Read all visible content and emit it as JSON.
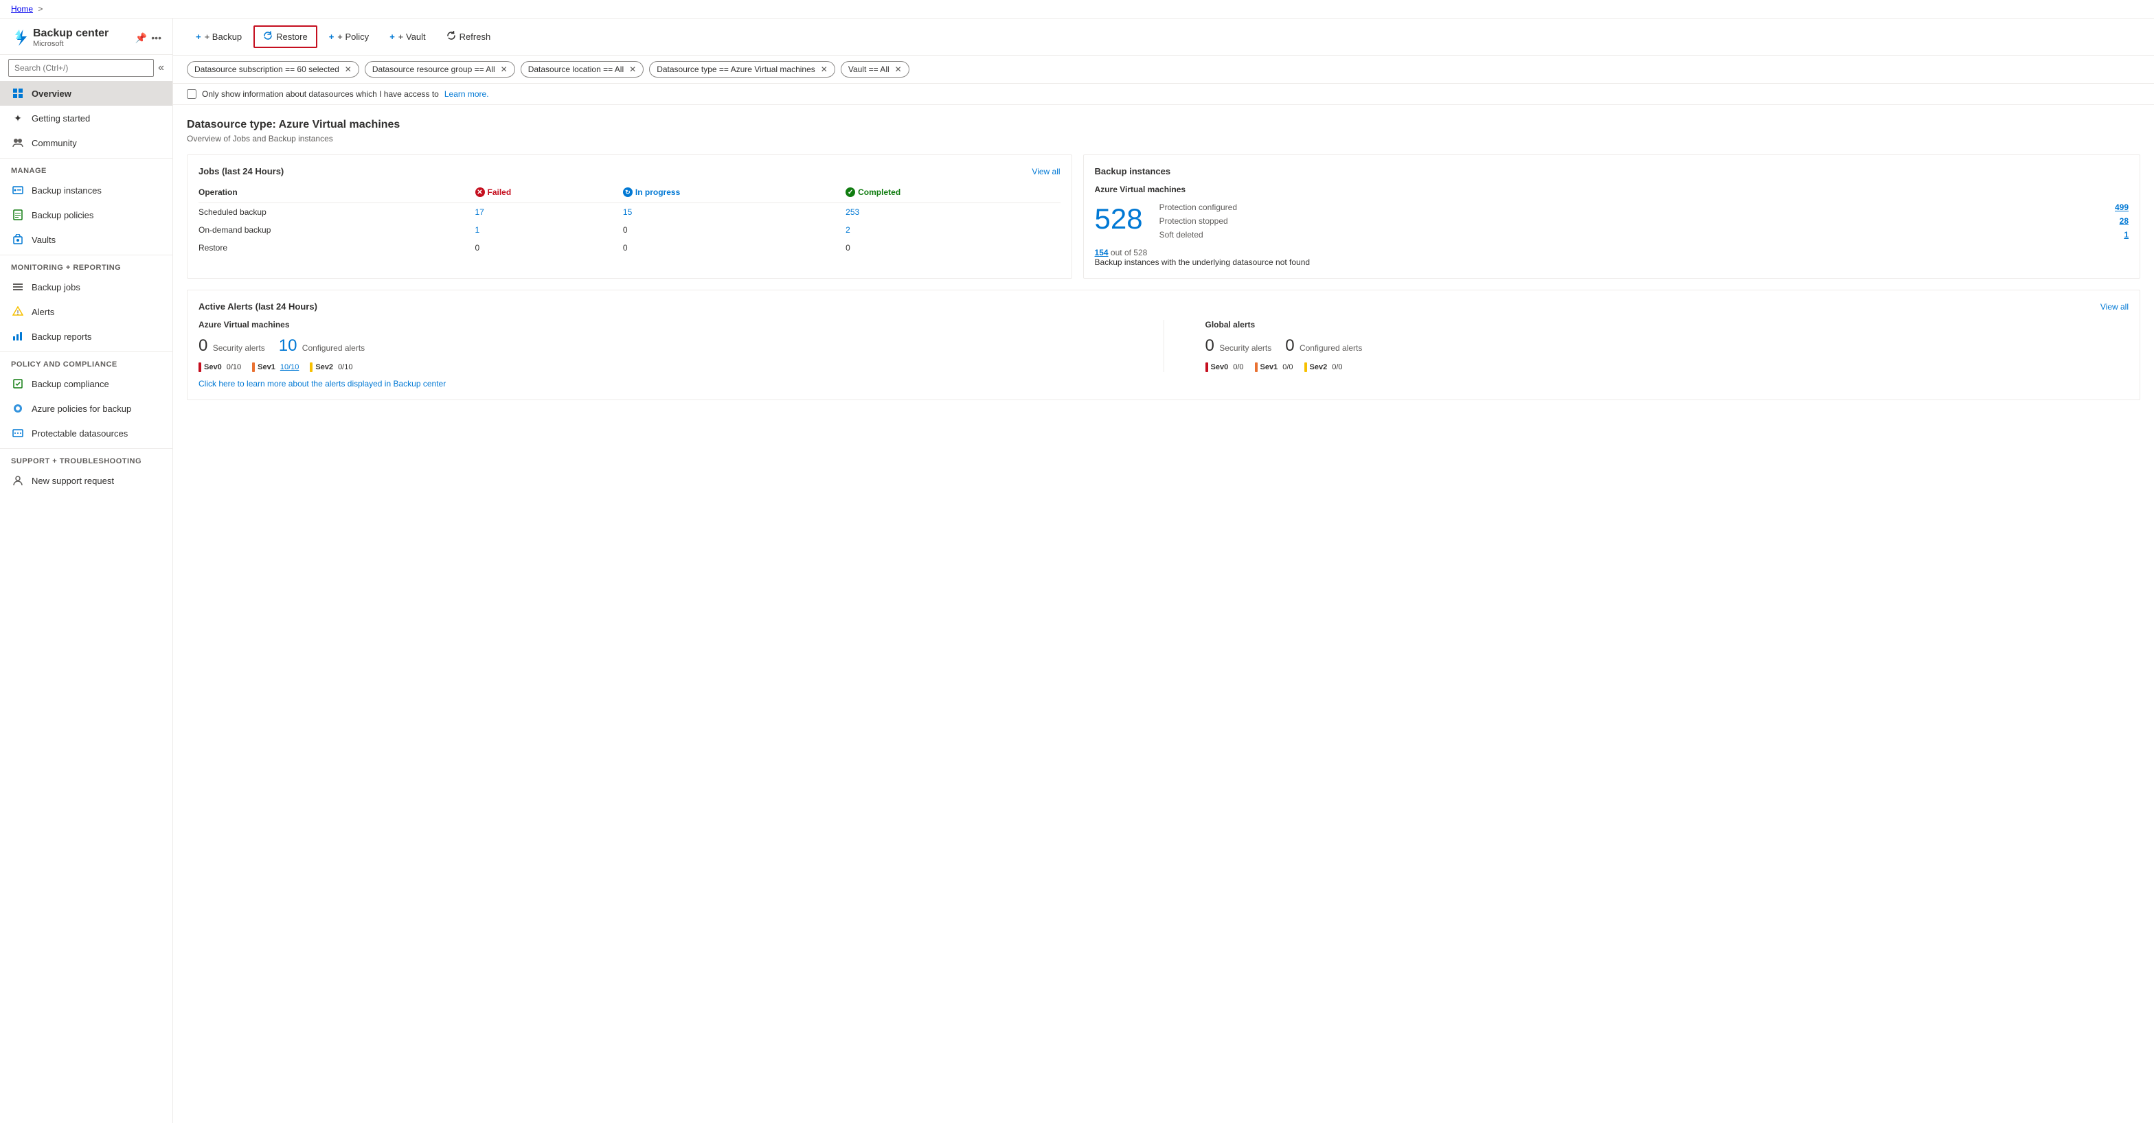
{
  "breadcrumb": {
    "home": "Home",
    "separator": ">"
  },
  "sidebar": {
    "title": "Backup center",
    "subtitle": "Microsoft",
    "search_placeholder": "Search (Ctrl+/)",
    "nav_items": [
      {
        "id": "overview",
        "label": "Overview",
        "icon": "⊟",
        "active": true
      },
      {
        "id": "getting-started",
        "label": "Getting started",
        "icon": "✦"
      },
      {
        "id": "community",
        "label": "Community",
        "icon": "👥"
      }
    ],
    "manage_section": "Manage",
    "manage_items": [
      {
        "id": "backup-instances",
        "label": "Backup instances",
        "icon": "📦"
      },
      {
        "id": "backup-policies",
        "label": "Backup policies",
        "icon": "📋"
      },
      {
        "id": "vaults",
        "label": "Vaults",
        "icon": "🔒"
      }
    ],
    "monitoring_section": "Monitoring + reporting",
    "monitoring_items": [
      {
        "id": "backup-jobs",
        "label": "Backup jobs",
        "icon": "≡"
      },
      {
        "id": "alerts",
        "label": "Alerts",
        "icon": "⚠"
      },
      {
        "id": "backup-reports",
        "label": "Backup reports",
        "icon": "📊"
      }
    ],
    "policy_section": "Policy and compliance",
    "policy_items": [
      {
        "id": "backup-compliance",
        "label": "Backup compliance",
        "icon": "✅"
      },
      {
        "id": "azure-policies",
        "label": "Azure policies for backup",
        "icon": "🔵"
      },
      {
        "id": "protectable-datasources",
        "label": "Protectable datasources",
        "icon": "🗄"
      }
    ],
    "support_section": "Support + troubleshooting",
    "support_items": [
      {
        "id": "new-support-request",
        "label": "New support request",
        "icon": "👤"
      }
    ]
  },
  "toolbar": {
    "backup_label": "+ Backup",
    "restore_label": "Restore",
    "policy_label": "+ Policy",
    "vault_label": "+ Vault",
    "refresh_label": "Refresh"
  },
  "filters": {
    "subscription": "Datasource subscription == 60 selected",
    "resource_group": "Datasource resource group == All",
    "location": "Datasource location == All",
    "datasource_type": "Datasource type == Azure Virtual machines",
    "vault": "Vault == All",
    "checkbox_label": "Only show information about datasources which I have access to",
    "learn_more": "Learn more."
  },
  "page": {
    "title": "Datasource type: Azure Virtual machines",
    "subtitle": "Overview of Jobs and Backup instances"
  },
  "jobs_card": {
    "title": "Jobs (last 24 Hours)",
    "view_all": "View all",
    "headers": {
      "operation": "Operation",
      "failed": "Failed",
      "in_progress": "In progress",
      "completed": "Completed"
    },
    "rows": [
      {
        "operation": "Scheduled backup",
        "failed": "17",
        "in_progress": "15",
        "completed": "253"
      },
      {
        "operation": "On-demand backup",
        "failed": "1",
        "in_progress": "0",
        "completed": "2"
      },
      {
        "operation": "Restore",
        "failed": "0",
        "in_progress": "0",
        "completed": "0"
      }
    ]
  },
  "backup_instances_card": {
    "title": "Backup instances",
    "subtitle": "Azure Virtual machines",
    "big_number": "528",
    "protection_configured_label": "Protection configured",
    "protection_configured_value": "499",
    "protection_stopped_label": "Protection stopped",
    "protection_stopped_value": "28",
    "soft_deleted_label": "Soft deleted",
    "soft_deleted_value": "1",
    "datasource_note_number": "154",
    "datasource_note_of": "out of 528",
    "datasource_note_text": "Backup instances with the underlying datasource not found"
  },
  "alerts_card": {
    "title": "Active Alerts (last 24 Hours)",
    "view_all": "View all",
    "azure_vm_section": "Azure Virtual machines",
    "azure_security_label": "Security alerts",
    "azure_security_count": "0",
    "azure_configured_label": "Configured alerts",
    "azure_configured_count": "10",
    "azure_sevs": [
      {
        "label": "Sev0",
        "value": "0/10",
        "color": "sev0-color"
      },
      {
        "label": "Sev1",
        "value": "10/10",
        "color": "sev1-color",
        "blue": true
      },
      {
        "label": "Sev2",
        "value": "0/10",
        "color": "sev2-color"
      }
    ],
    "global_section": "Global alerts",
    "global_security_label": "Security alerts",
    "global_security_count": "0",
    "global_configured_label": "Configured alerts",
    "global_configured_count": "0",
    "global_sevs": [
      {
        "label": "Sev0",
        "value": "0/0",
        "color": "sev0-color"
      },
      {
        "label": "Sev1",
        "value": "0/0",
        "color": "sev1-color"
      },
      {
        "label": "Sev2",
        "value": "0/0",
        "color": "sev2-color"
      }
    ],
    "link_text": "Click here to learn more about the alerts displayed in Backup center"
  }
}
